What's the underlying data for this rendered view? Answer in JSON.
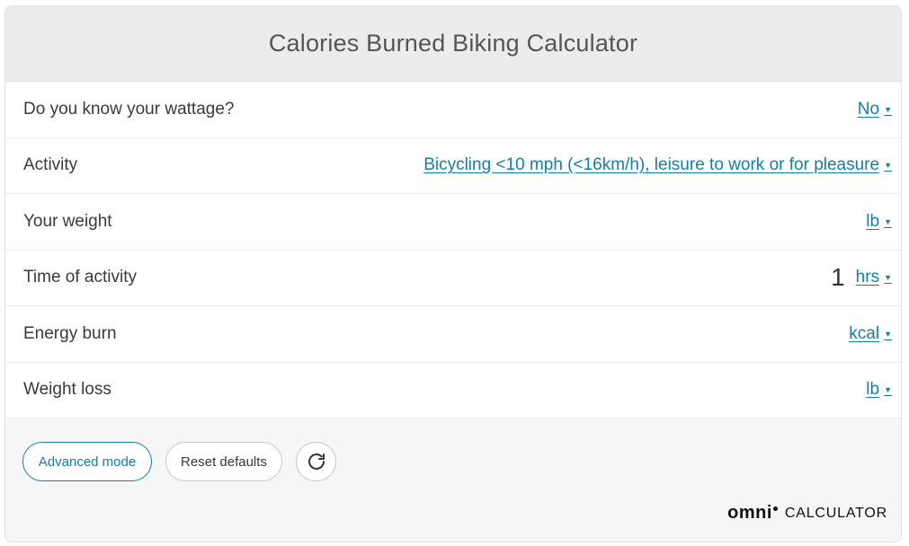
{
  "title": "Calories Burned Biking Calculator",
  "rows": [
    {
      "label": "Do you know your wattage?",
      "value": "",
      "unit": "No"
    },
    {
      "label": "Activity",
      "value": "",
      "unit": "Bicycling <10 mph (<16km/h), leisure to work or for pleasure"
    },
    {
      "label": "Your weight",
      "value": "",
      "unit": "lb"
    },
    {
      "label": "Time of activity",
      "value": "1",
      "unit": "hrs"
    },
    {
      "label": "Energy burn",
      "value": "",
      "unit": "kcal"
    },
    {
      "label": "Weight loss",
      "value": "",
      "unit": "lb"
    }
  ],
  "buttons": {
    "advanced": "Advanced mode",
    "reset": "Reset defaults"
  },
  "icons": {
    "dropdown": "caret-down-icon",
    "refresh": "refresh-icon"
  },
  "logo": {
    "brand": "omni",
    "product": "CALCULATOR"
  },
  "colors": {
    "link": "#137fa8",
    "header_bg": "#ececec",
    "footer_bg": "#f6f6f6"
  }
}
